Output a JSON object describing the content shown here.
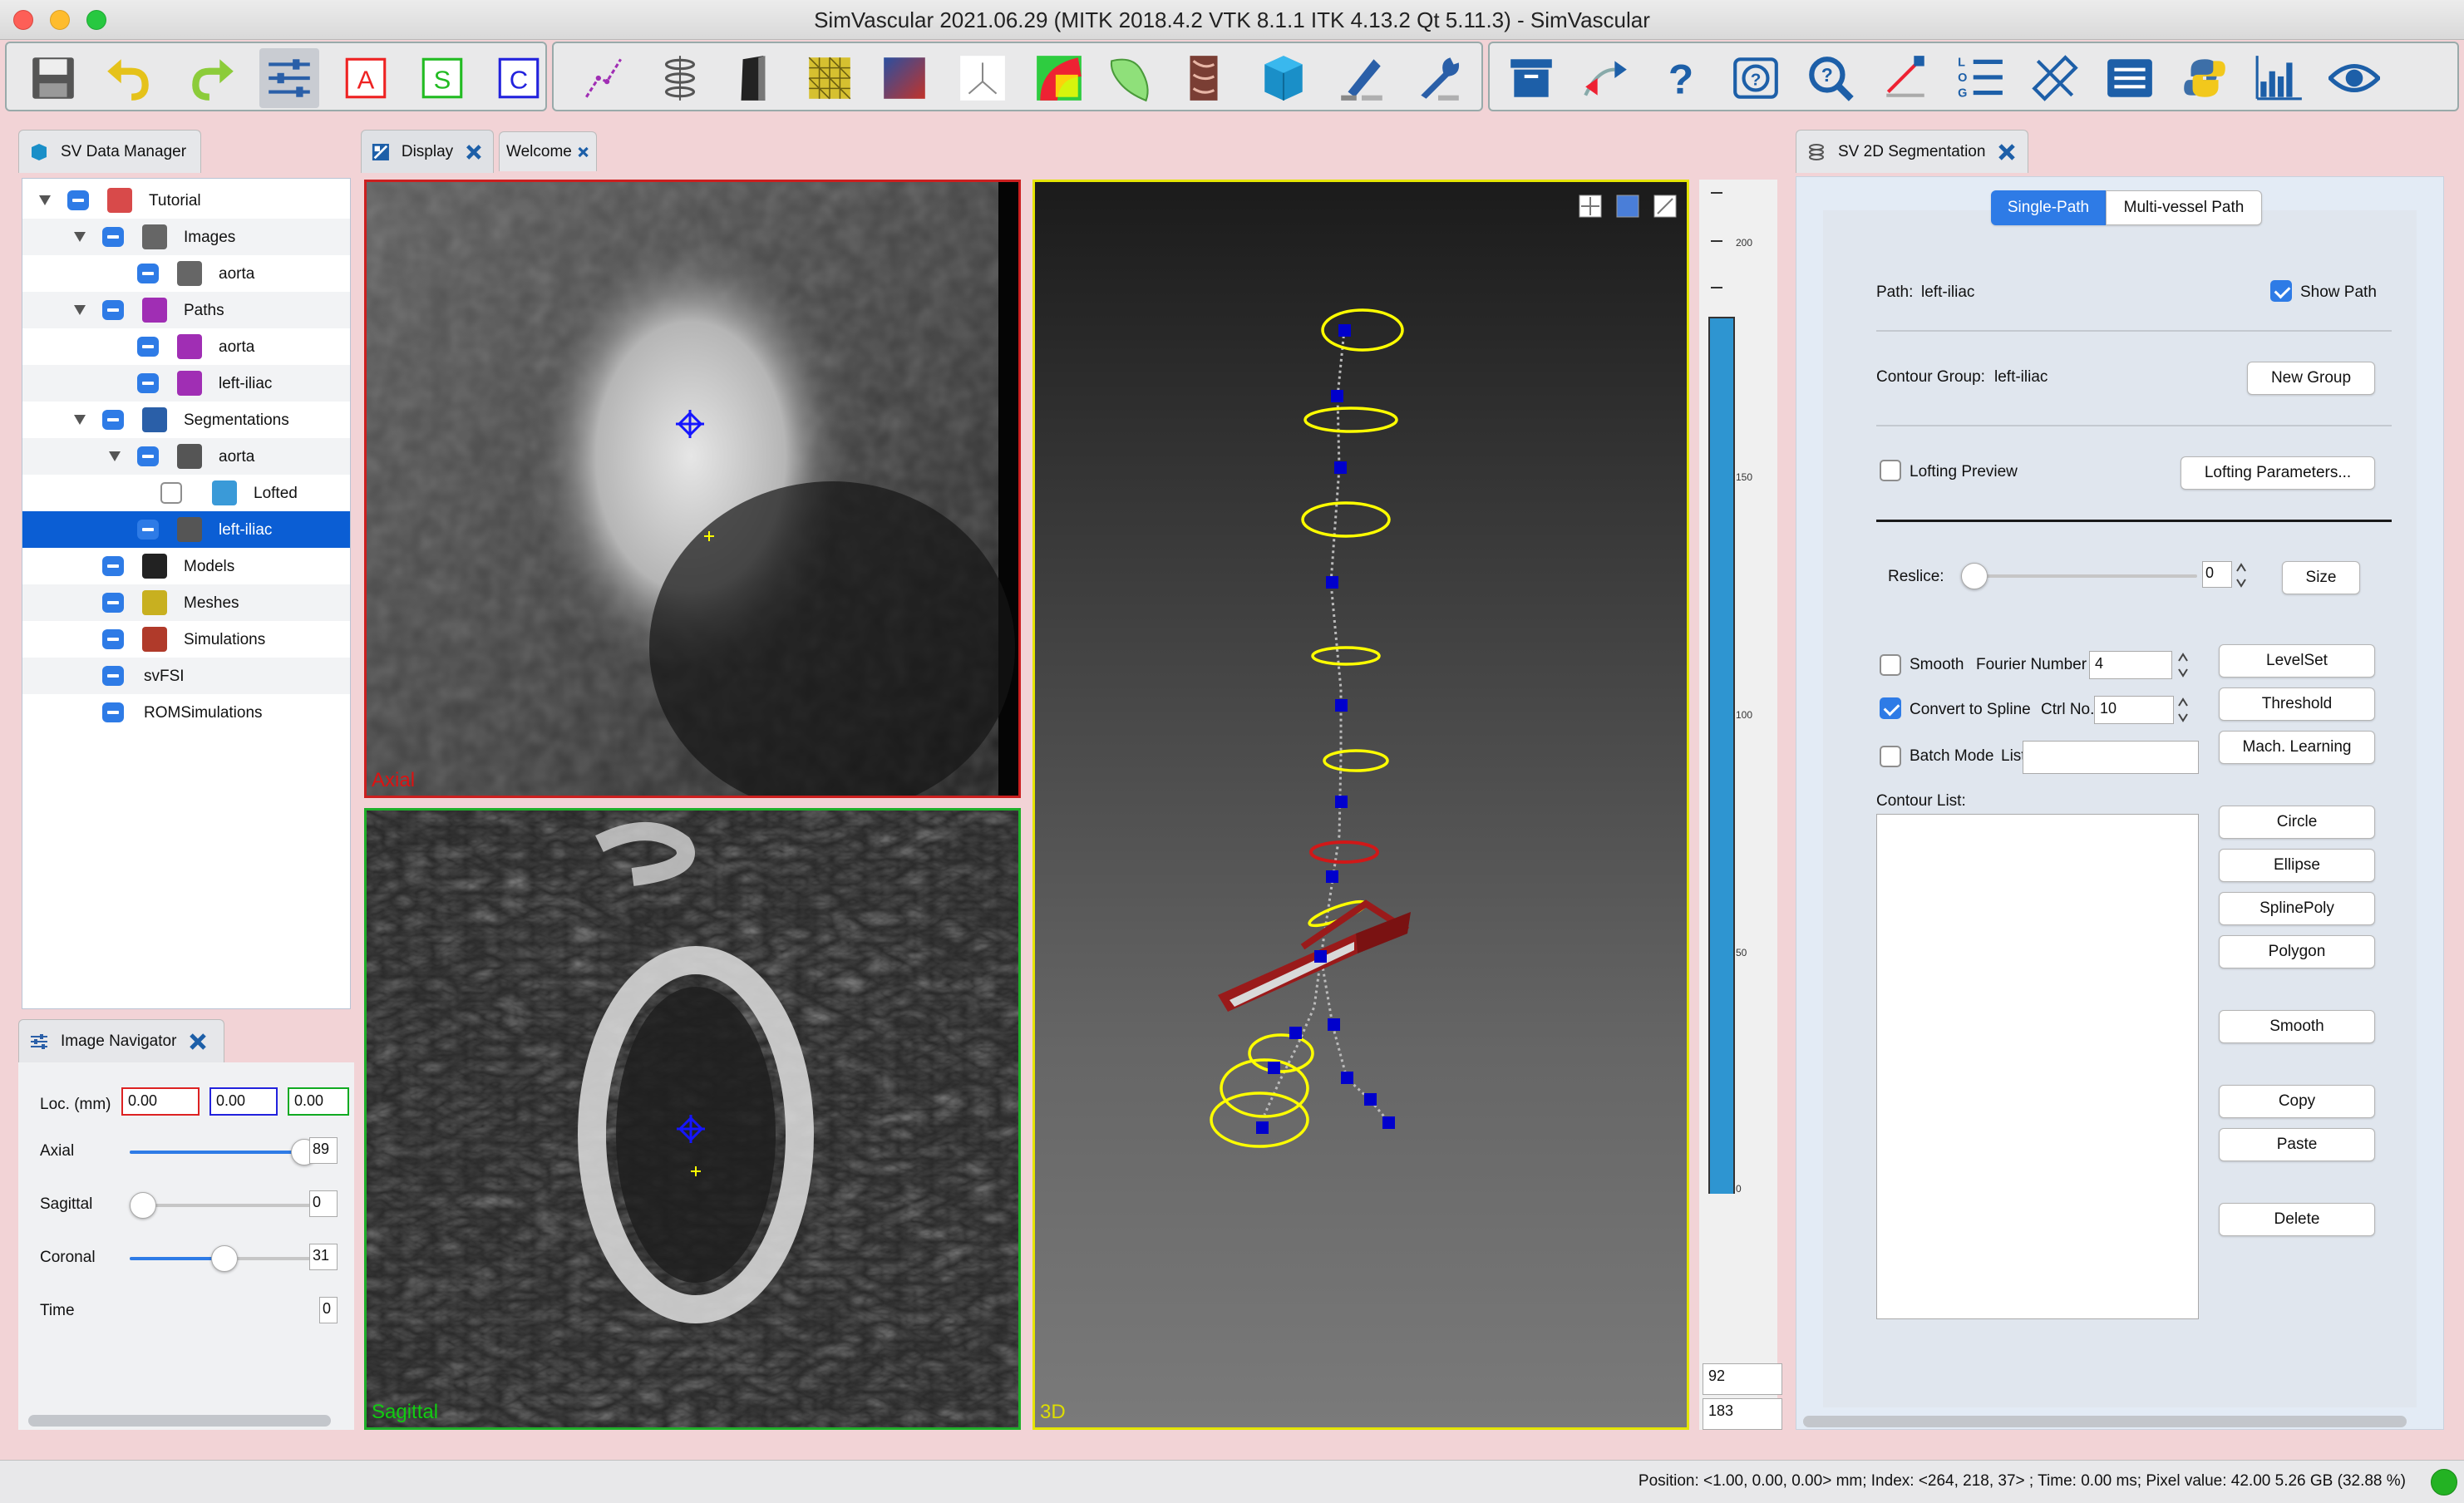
{
  "window": {
    "title": "SimVascular 2021.06.29 (MITK 2018.4.2 VTK 8.1.1 ITK 4.13.2 Qt 5.11.3) - SimVascular"
  },
  "toolbar": {
    "tools": [
      "save-icon",
      "undo-icon",
      "redo-icon",
      "sliders-icon",
      "A",
      "S",
      "C",
      "path-icon",
      "segmentation-icon",
      "model-icon",
      "mesh-icon",
      "simulation-icon",
      "axes-icon",
      "color-volume-icon",
      "surface-icon",
      "clipping-icon",
      "cube-icon",
      "edit-tool-icon",
      "wrench-icon",
      "archive-icon",
      "transfer-icon",
      "help-icon",
      "help-list-icon",
      "zoom-icon",
      "measure-icon",
      "log-list-icon",
      "ruler-icon",
      "list-icon",
      "python-icon",
      "bar-chart-icon",
      "eye-icon"
    ],
    "active_tool": "sliders-icon"
  },
  "data_manager": {
    "tab": "SV Data Manager",
    "tree": [
      {
        "label": "Tutorial",
        "level": 0
      },
      {
        "label": "Images",
        "level": 1
      },
      {
        "label": "aorta",
        "level": 2
      },
      {
        "label": "Paths",
        "level": 1
      },
      {
        "label": "aorta",
        "level": 2
      },
      {
        "label": "left-iliac",
        "level": 2
      },
      {
        "label": "Segmentations",
        "level": 1
      },
      {
        "label": "aorta",
        "level": 2
      },
      {
        "label": "Lofted",
        "level": 3
      },
      {
        "label": "left-iliac",
        "level": 2,
        "selected": true
      },
      {
        "label": "Models",
        "level": 1
      },
      {
        "label": "Meshes",
        "level": 1
      },
      {
        "label": "Simulations",
        "level": 1
      },
      {
        "label": "svFSI",
        "level": 1
      },
      {
        "label": "ROMSimulations",
        "level": 1
      }
    ]
  },
  "image_navigator": {
    "tab": "Image Navigator",
    "loc_label": "Loc. (mm)",
    "loc_values": [
      "0.00",
      "0.00",
      "0.00"
    ],
    "sliders": [
      {
        "label": "Axial",
        "value": "89",
        "level": 0.92
      },
      {
        "label": "Sagittal",
        "value": "0",
        "level": 0.0
      },
      {
        "label": "Coronal",
        "value": "31",
        "level": 0.5
      },
      {
        "label": "Time",
        "value": "0"
      }
    ]
  },
  "display": {
    "tabs": [
      "Display",
      "Welcome"
    ],
    "views": {
      "axial": "Axial",
      "sagittal": "Sagittal",
      "three_d": "3D"
    },
    "colorbar_ticks": [
      "200",
      "150",
      "100",
      "50",
      "0"
    ],
    "colorbar_readouts": [
      "92",
      "183"
    ]
  },
  "segmentation": {
    "tab": "SV 2D Segmentation",
    "mode_tabs": [
      "Single-Path",
      "Multi-vessel Path"
    ],
    "active_mode": "Single-Path",
    "path_label": "Path:",
    "path_value": "left-iliac",
    "show_path": "Show Path",
    "contour_group_label": "Contour Group:",
    "contour_group_value": "left-iliac",
    "new_group": "New Group",
    "lofting_preview": "Lofting Preview",
    "lofting_params": "Lofting Parameters...",
    "reslice_label": "Reslice:",
    "reslice_value": "0",
    "size_button": "Size",
    "smooth_label": "Smooth",
    "fourier_label": "Fourier Number",
    "fourier_value": "4",
    "spline_label": "Convert to Spline",
    "ctrl_label": "Ctrl No.",
    "ctrl_value": "10",
    "batch_label": "Batch Mode",
    "list_label": "List",
    "contour_list_label": "Contour List:",
    "method_buttons": [
      "LevelSet",
      "Threshold",
      "Mach. Learning"
    ],
    "shape_buttons": [
      "Circle",
      "Ellipse",
      "SplinePoly",
      "Polygon"
    ],
    "smooth_button": "Smooth",
    "edit_buttons": [
      "Copy",
      "Paste"
    ],
    "delete_button": "Delete"
  },
  "status": {
    "text": "Position: <1.00, 0.00, 0.00> mm; Index: <264, 218, 37> ; Time: 0.00 ms; Pixel value: 42.00   5.26 GB (32.88 %)"
  },
  "colors": {
    "accent": "#0b5ed4",
    "axial_border": "#cc1f1f",
    "sagittal_border": "#1fae2a",
    "threed_border": "#e4e400",
    "contour": "#ffff00",
    "path_point": "#0000cc"
  }
}
